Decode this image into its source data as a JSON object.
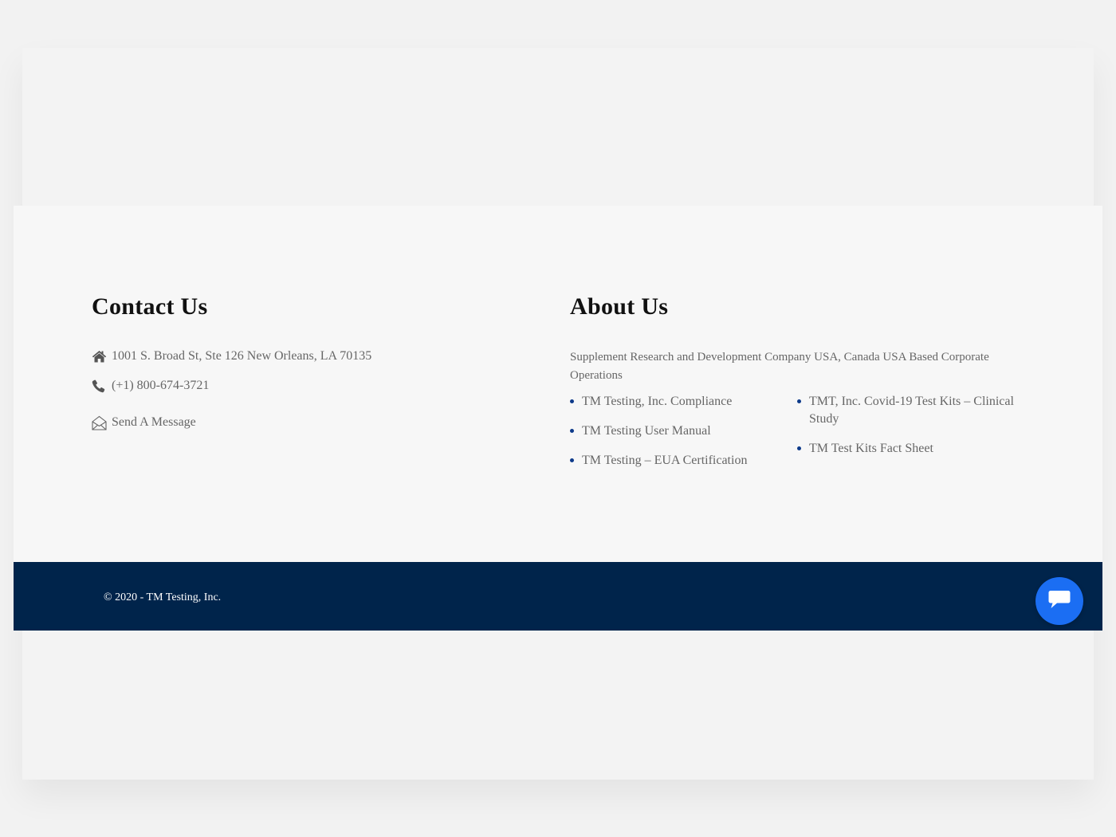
{
  "contact": {
    "heading": "Contact Us",
    "address": "1001 S. Broad St, Ste 126 New Orleans, LA 70135",
    "phone": "(+1) 800-674-3721",
    "message_link": "Send A Message",
    "icons": [
      "home-icon",
      "phone-icon",
      "envelope-open-icon"
    ]
  },
  "about": {
    "heading": "About Us",
    "description": "Supplement Research and Development Company USA, Canada USA Based Corporate Operations",
    "links_col1": [
      "TM Testing, Inc. Compliance",
      "TM Testing User Manual",
      "TM Testing – EUA Certification"
    ],
    "links_col2": [
      "TMT, Inc. Covid-19 Test Kits – Clinical Study",
      "TM Test Kits Fact Sheet"
    ]
  },
  "footer": {
    "copyright": "© 2020 - TM Testing, Inc.",
    "chat_icon": "chat-bubble-icon"
  },
  "colors": {
    "page_bg": "#f2f2f2",
    "footer_main_bg": "#f7f7f7",
    "footer_bar_bg": "#00244b",
    "bullet": "#0d3a8a",
    "chat_button": "#1b6ef3",
    "text": "#666666",
    "heading": "#111111"
  }
}
